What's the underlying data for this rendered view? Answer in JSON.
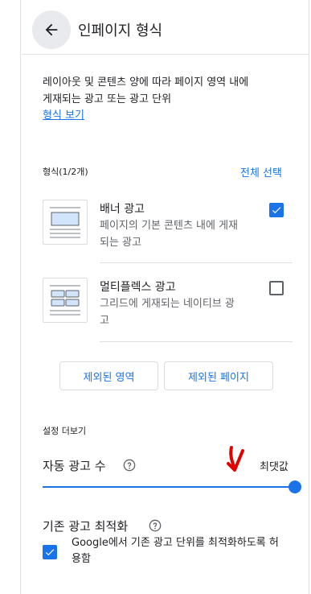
{
  "header": {
    "title": "인페이지 형식",
    "back_icon": "arrow-back-icon"
  },
  "intro": {
    "line1": "레이아웃 및 콘텐츠 양에 따라 페이지 영역 내에",
    "line2": "게재되는 광고 또는 광고 단위",
    "view_formats_link": "형식 보기"
  },
  "formats": {
    "label": "형식(1/2개)",
    "select_all": "전체 선택",
    "items": [
      {
        "title": "배너 광고",
        "desc_line1": "페이지의 기본 콘텐츠 내에 게재",
        "desc_line2": "되는 광고",
        "checked": true,
        "icon": "banner-ad-thumbnail"
      },
      {
        "title": "멀티플렉스 광고",
        "desc_line1": "그리드에 게재되는 네이티브 광",
        "desc_line2": "고",
        "checked": false,
        "icon": "multiplex-ad-thumbnail"
      }
    ]
  },
  "buttons": {
    "excluded_areas": "제외된 영역",
    "excluded_pages": "제외된 페이지"
  },
  "settings": {
    "label": "설정 더보기",
    "auto_ads_label": "자동 광고 수",
    "max_label": "최댓값",
    "slider_value_fraction": 1.0
  },
  "optimize": {
    "title": "기존 광고 최적화",
    "desc_line1": "Google에서 기존 광고 단위를 최적화하도록 허",
    "desc_line2": "용함",
    "checked": true
  },
  "colors": {
    "accent": "#1a73e8",
    "annotation_red": "#e00000",
    "text_secondary": "#5f6368",
    "border": "#dadce0"
  }
}
